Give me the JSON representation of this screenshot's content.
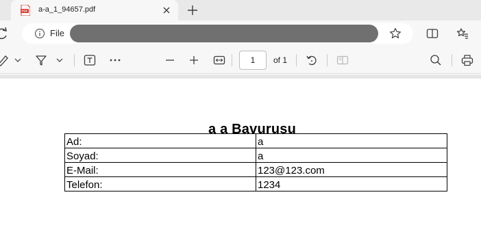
{
  "browser": {
    "tab": {
      "title": "a-a_1_94657.pdf",
      "icon": "pdf-file-icon"
    },
    "address": {
      "scheme_label": "File",
      "url_redacted": true
    },
    "accent": "#d93025"
  },
  "toolbar": {
    "page": {
      "current": "1",
      "total_label": "of 1"
    },
    "icons": [
      "draw-icon",
      "highlight-icon",
      "text-icon",
      "more-icon",
      "zoom-out-icon",
      "zoom-in-icon",
      "fit-width-icon",
      "rotate-icon",
      "two-page-icon",
      "search-icon",
      "print-icon"
    ]
  },
  "document": {
    "title": "a a  Bavurusu",
    "rows": [
      {
        "label": "Ad:",
        "value": "a"
      },
      {
        "label": "Soyad:",
        "value": "a"
      },
      {
        "label": "E-Mail:",
        "value": "123@123.com"
      },
      {
        "label": "Telefon:",
        "value": "1234"
      }
    ]
  }
}
